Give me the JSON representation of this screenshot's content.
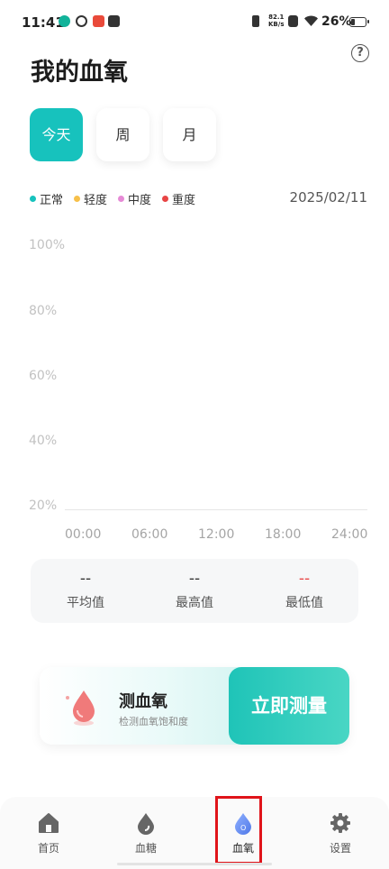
{
  "status": {
    "time": "11:41",
    "net_speed_value": "82.1",
    "net_speed_unit": "KB/s",
    "battery": "26%"
  },
  "header": {
    "title": "我的血氧",
    "help_icon": "?"
  },
  "tabs": [
    {
      "label": "今天",
      "active": true
    },
    {
      "label": "周",
      "active": false
    },
    {
      "label": "月",
      "active": false
    }
  ],
  "legend": [
    {
      "label": "正常",
      "color": "#17c2bd"
    },
    {
      "label": "轻度",
      "color": "#f7c04a"
    },
    {
      "label": "中度",
      "color": "#e68ad6"
    },
    {
      "label": "重度",
      "color": "#e84545"
    }
  ],
  "date": "2025/02/11",
  "chart_data": {
    "type": "scatter",
    "y_ticks": [
      "100%",
      "80%",
      "60%",
      "40%",
      "20%"
    ],
    "x_ticks": [
      "00:00",
      "06:00",
      "12:00",
      "18:00",
      "24:00"
    ],
    "ylim": [
      20,
      100
    ],
    "series": []
  },
  "stats": [
    {
      "value": "--",
      "label": "平均值"
    },
    {
      "value": "--",
      "label": "最高值"
    },
    {
      "value": "--",
      "label": "最低值"
    }
  ],
  "measure": {
    "title": "测血氧",
    "subtitle": "检测血氧饱和度",
    "button": "立即测量"
  },
  "nav": [
    {
      "label": "首页",
      "icon": "home-icon"
    },
    {
      "label": "血糖",
      "icon": "blood-sugar-icon"
    },
    {
      "label": "血氧",
      "icon": "blood-oxygen-icon",
      "active": true
    },
    {
      "label": "设置",
      "icon": "gear-icon"
    }
  ],
  "colors": {
    "accent": "#17c2bd",
    "highlight": "#e0141a"
  }
}
